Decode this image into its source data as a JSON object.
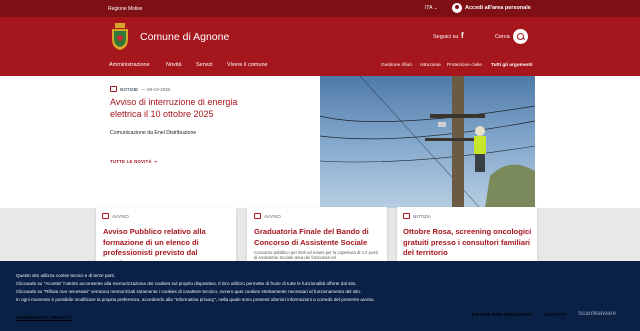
{
  "topbar": {
    "region": "Regione Molise",
    "lang": "ITA",
    "login": "Accedi all'area personale"
  },
  "header": {
    "title": "Comune di Agnone",
    "social": "Seguici su",
    "facebook": "f",
    "search": "Cerca"
  },
  "nav": {
    "items": [
      "Amministrazione",
      "Novità",
      "Servizi",
      "Vivere il comune"
    ],
    "secondary": [
      "Gestione rifiuti",
      "Istruzione",
      "Protezione civile",
      "Tutti gli argomenti"
    ]
  },
  "hero": {
    "tag": "NOTIZIE",
    "date": "— 09-10-2025",
    "title": "Avviso di interruzione di energia elettrica il 10 ottobre 2025",
    "subtitle": "Comunicazione da Enel Distribuzione",
    "link": "TUTTE LE NOVITÀ ➝"
  },
  "cards": [
    {
      "tag": "AVVISO",
      "title": "Avviso Pubblico relativo alla formazione di un elenco di professionisti previsto dal Bando",
      "text": ""
    },
    {
      "tag": "AVVISO",
      "title": "Graduatoria Finale del Bando di Concorso di Assistente Sociale",
      "text": "Concorso pubblico per titoli ed esami per la copertura di n.2 posti di Assistente Sociale area dei funzionari ed"
    },
    {
      "tag": "NOTIZIA",
      "title": "Ottobre Rosa, screening oncologici gratuiti presso i consultori familiari del territorio",
      "text": ""
    }
  ],
  "cookie": {
    "lines": [
      "Questo sito utilizza cookie tecnici e di terze parti.",
      "Cliccando su \"Accetta\" l'utente acconsente alla memorizzazione dei cookies sul proprio dispositivo. Il loro utilizzo permette di fruire di tutte le funzionalità offerte dal sito.",
      "Cliccando su \"Rifiuta non necessari\" verranno memorizzati solamente i cookies di carattere tecnico, ovvero quei cookies strettamente necessari al funzionamento del sito.",
      "In ogni momento è possibile modificare la propria preferenza, accedendo alla \"Informativa privacy\", nella quale sono presenti ulteriori informazioni a corredo del presente avviso."
    ],
    "policy": "INFORMATIVA PRIVACY",
    "reject": "RIFIUTA NON NECESSARI",
    "accept": "ACCETTA",
    "watermark": "ScanMalware"
  }
}
